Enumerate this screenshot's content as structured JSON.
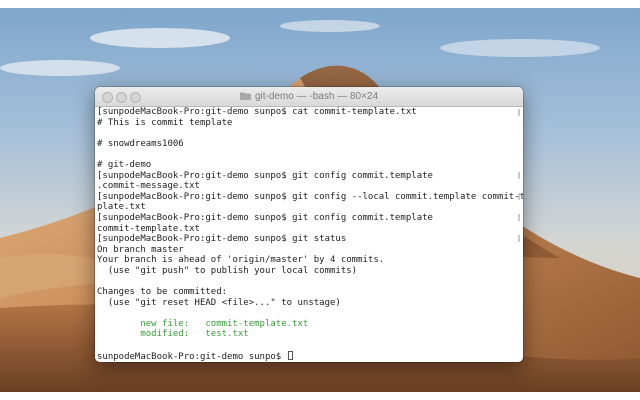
{
  "desktop": {
    "wallpaper": "desert-dunes"
  },
  "window": {
    "title": "git-demo — -bash — 80×24",
    "folder_icon": "folder-icon"
  },
  "terminal": {
    "lines": [
      {
        "text": "[sunpodeMacBook-Pro:git-demo sunpo$ cat commit-template.txt",
        "color": "default"
      },
      {
        "text": "# This is commit template",
        "color": "default"
      },
      {
        "text": "",
        "color": "default"
      },
      {
        "text": "# snowdreams1006",
        "color": "default"
      },
      {
        "text": "",
        "color": "default"
      },
      {
        "text": "# git-demo",
        "color": "default"
      },
      {
        "text": "[sunpodeMacBook-Pro:git-demo sunpo$ git config commit.template",
        "color": "default"
      },
      {
        "text": ".commit-message.txt",
        "color": "default"
      },
      {
        "text": "[sunpodeMacBook-Pro:git-demo sunpo$ git config --local commit.template commit-tem",
        "color": "default"
      },
      {
        "text": "plate.txt",
        "color": "default"
      },
      {
        "text": "[sunpodeMacBook-Pro:git-demo sunpo$ git config commit.template",
        "color": "default"
      },
      {
        "text": "commit-template.txt",
        "color": "default"
      },
      {
        "text": "[sunpodeMacBook-Pro:git-demo sunpo$ git status",
        "color": "default"
      },
      {
        "text": "On branch master",
        "color": "default"
      },
      {
        "text": "Your branch is ahead of 'origin/master' by 4 commits.",
        "color": "default"
      },
      {
        "text": "  (use \"git push\" to publish your local commits)",
        "color": "default"
      },
      {
        "text": "",
        "color": "default"
      },
      {
        "text": "Changes to be committed:",
        "color": "default"
      },
      {
        "text": "  (use \"git reset HEAD <file>...\" to unstage)",
        "color": "default"
      },
      {
        "text": "",
        "color": "default"
      },
      {
        "text": "\tnew file:   commit-template.txt",
        "color": "green"
      },
      {
        "text": "\tmodified:   test.txt",
        "color": "green"
      },
      {
        "text": "",
        "color": "default"
      }
    ],
    "prompt": "sunpodeMacBook-Pro:git-demo sunpo$ ",
    "colors": {
      "text": "#1e1e1e",
      "staged": "#3c9a3c",
      "background": "#ffffff"
    }
  }
}
